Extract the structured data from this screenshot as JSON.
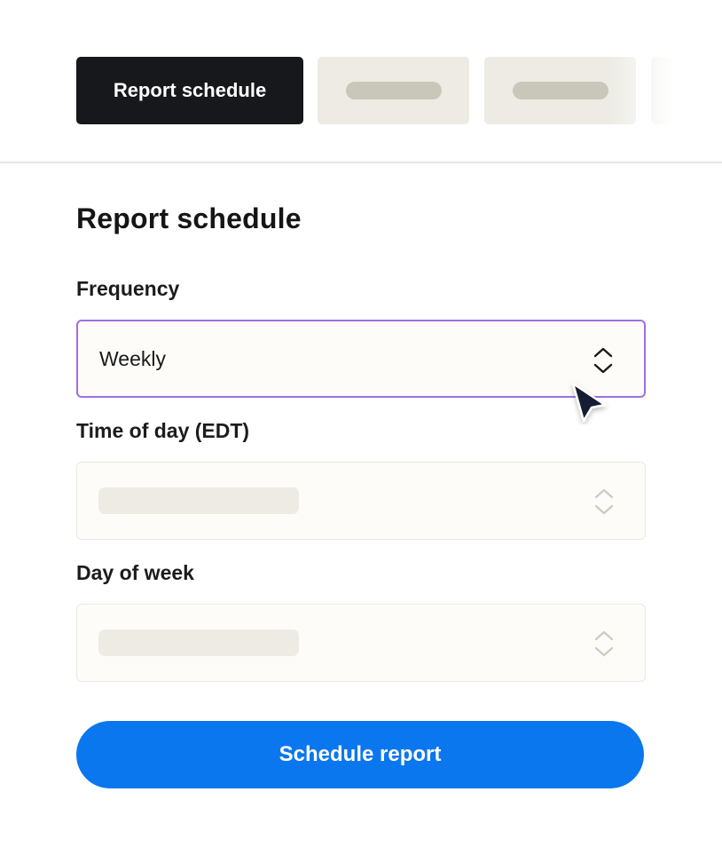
{
  "tabs": {
    "active_label": "Report schedule"
  },
  "section": {
    "title": "Report schedule"
  },
  "form": {
    "frequency": {
      "label": "Frequency",
      "value": "Weekly"
    },
    "time_of_day": {
      "label": "Time of day (EDT)"
    },
    "day_of_week": {
      "label": "Day of week"
    }
  },
  "cta": {
    "label": "Schedule report"
  },
  "colors": {
    "accent": "#0a77ee",
    "focus_border": "#a06ee6",
    "active_tab": "#17181c"
  },
  "icons": [
    "chevron-up-down-icon",
    "cursor-arrow-icon"
  ]
}
